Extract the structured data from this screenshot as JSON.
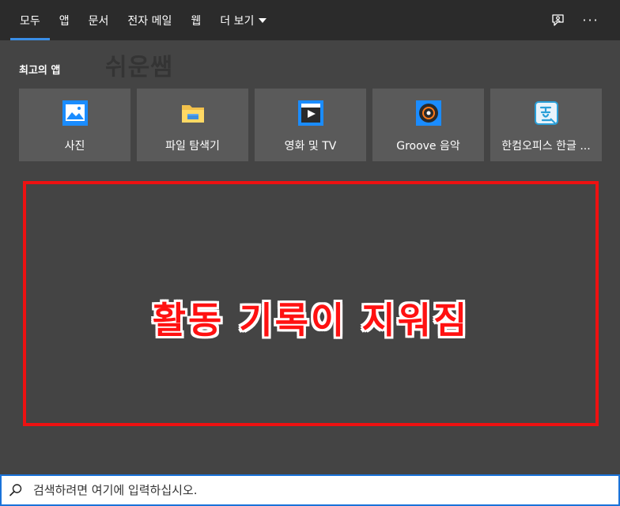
{
  "nav": {
    "tabs": [
      {
        "label": "모두",
        "active": true
      },
      {
        "label": "앱"
      },
      {
        "label": "문서"
      },
      {
        "label": "전자 메일"
      },
      {
        "label": "웹"
      },
      {
        "label": "더 보기"
      }
    ],
    "accent_color": "#3a8ee6",
    "feedback_icon": "feedback-icon",
    "more_icon": "more-options-icon"
  },
  "watermark": "쉬운쌤",
  "top_apps": {
    "heading": "최고의 앱",
    "items": [
      {
        "label": "사진",
        "icon": "photos-icon"
      },
      {
        "label": "파일 탐색기",
        "icon": "file-explorer-icon"
      },
      {
        "label": "영화 및 TV",
        "icon": "movies-tv-icon"
      },
      {
        "label": "Groove 음악",
        "icon": "groove-music-icon"
      },
      {
        "label": "한컴오피스 한글 ...",
        "icon": "hancom-hangul-icon"
      }
    ]
  },
  "annotation": {
    "text": "활동 기록이 지워짐",
    "color": "#ff1111"
  },
  "search": {
    "placeholder": "검색하려면 여기에 입력하십시오.",
    "value": ""
  }
}
